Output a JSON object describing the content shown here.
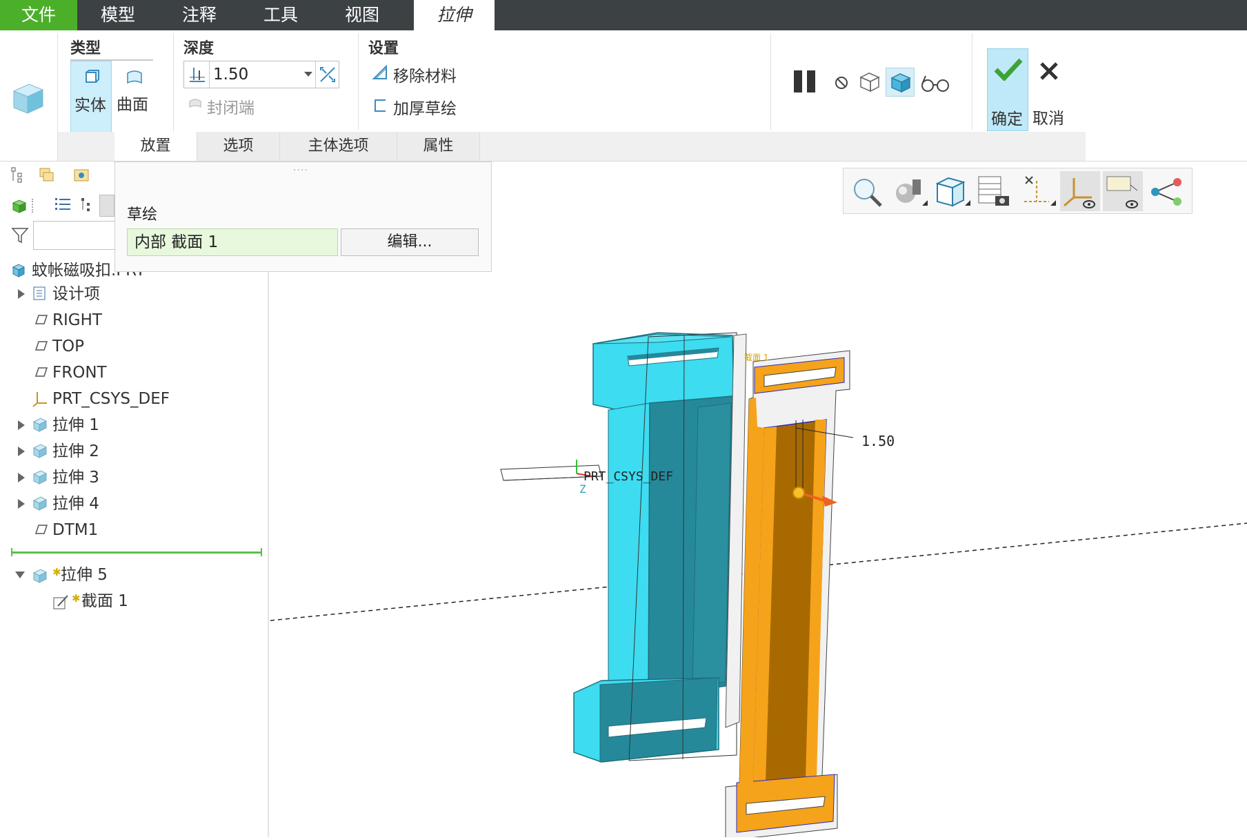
{
  "tabs": [
    {
      "label": "文件"
    },
    {
      "label": "模型"
    },
    {
      "label": "注释"
    },
    {
      "label": "工具"
    },
    {
      "label": "视图"
    },
    {
      "label": "拉伸"
    }
  ],
  "ribbon": {
    "type_group": {
      "label": "类型",
      "solid": "实体",
      "surface": "曲面"
    },
    "depth_group": {
      "label": "深度",
      "value": "1.50",
      "capped_ends": "封闭端"
    },
    "settings_group": {
      "label": "设置",
      "remove_material": "移除材料",
      "thicken_sketch": "加厚草绘"
    },
    "confirm": "确定",
    "cancel": "取消"
  },
  "subtabs": [
    {
      "label": "放置"
    },
    {
      "label": "选项"
    },
    {
      "label": "主体选项"
    },
    {
      "label": "属性"
    }
  ],
  "placement_panel": {
    "sketch_label": "草绘",
    "sketch_value": "内部 截面 1",
    "edit_button": "编辑..."
  },
  "model_tree": {
    "root": "蚊帐磁吸扣.PRT",
    "items": [
      {
        "label": "设计项",
        "icon": "design-items-icon",
        "expandable": true
      },
      {
        "label": "RIGHT",
        "icon": "datum-plane-icon",
        "expandable": false
      },
      {
        "label": "TOP",
        "icon": "datum-plane-icon",
        "expandable": false
      },
      {
        "label": "FRONT",
        "icon": "datum-plane-icon",
        "expandable": false
      },
      {
        "label": "PRT_CSYS_DEF",
        "icon": "csys-icon",
        "expandable": false
      },
      {
        "label": "拉伸 1",
        "icon": "extrude-icon",
        "expandable": true
      },
      {
        "label": "拉伸 2",
        "icon": "extrude-icon",
        "expandable": true
      },
      {
        "label": "拉伸 3",
        "icon": "extrude-icon",
        "expandable": true
      },
      {
        "label": "拉伸 4",
        "icon": "extrude-icon",
        "expandable": true
      },
      {
        "label": "DTM1",
        "icon": "datum-plane-icon",
        "expandable": false
      }
    ],
    "active_feature": "拉伸 5",
    "active_child": "截面 1"
  },
  "viewport": {
    "dimension_label": "1.50",
    "csys_label": "PRT_CSYS_DEF",
    "section_tag": "截面 1",
    "axis_label": "Z"
  },
  "colors": {
    "file_tab": "#4caf2a",
    "model_cyan": "#3ddcf0",
    "model_cyan_dark": "#26899a",
    "model_orange": "#f5a31a",
    "model_brown": "#a86a00"
  }
}
